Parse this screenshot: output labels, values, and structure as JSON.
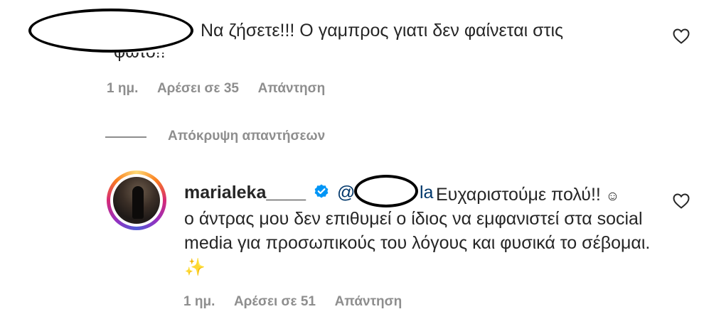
{
  "top_comment": {
    "text": "Να ζήσετε!!! Ο γαμπρος γιατι δεν φαίνεται στις",
    "cut_line": "φωτο!!",
    "meta": {
      "time": "1 ημ.",
      "likes": "Αρέσει σε 35",
      "reply": "Απάντηση"
    }
  },
  "hide_replies_label": "Απόκρυψη απαντήσεων",
  "reply": {
    "username": "marialeka____",
    "mention_prefix": "@",
    "mention_suffix": "la",
    "line1": "Ευχαριστούμε πολύ!!",
    "smile": "☺",
    "body": "ο άντρας μου δεν επιθυμεί ο ίδιος να εμφανιστεί στα social media για προσωπικούς του λόγους και φυσικά το σέβομαι.",
    "sparkle": "✨",
    "meta": {
      "time": "1 ημ.",
      "likes": "Αρέσει σε 51",
      "reply": "Απάντηση"
    }
  },
  "colors": {
    "text": "#262626",
    "secondary": "#8e8e8e",
    "verified": "#0095f6",
    "mention": "#00376b"
  },
  "icons": {
    "like": "heart-outline-icon",
    "verified": "verified-badge-icon"
  }
}
